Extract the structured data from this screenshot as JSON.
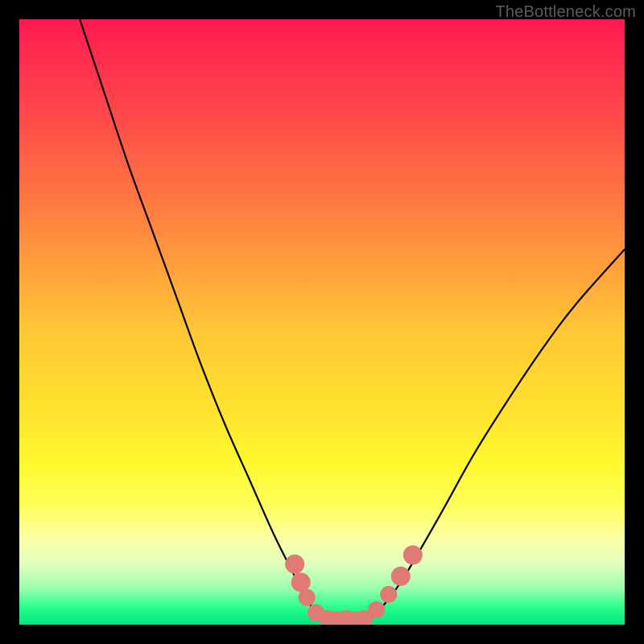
{
  "watermark": "TheBottleneck.com",
  "colors": {
    "frame_bg_top": "#ff1a52",
    "frame_bg_bottom": "#00e67a",
    "curve": "#000000",
    "marker": "#e07a74",
    "page_bg": "#000000",
    "watermark_text": "#5c5c5c"
  },
  "chart_data": {
    "type": "line",
    "title": "",
    "xlabel": "",
    "ylabel": "",
    "xlim": [
      0,
      100
    ],
    "ylim": [
      0,
      100
    ],
    "series": [
      {
        "name": "left-branch",
        "x": [
          10,
          14,
          18,
          22,
          26,
          30,
          34,
          38,
          42,
          45,
          47,
          49,
          50
        ],
        "y": [
          100,
          88,
          76,
          65,
          54,
          43,
          33,
          24,
          15,
          9,
          5,
          2,
          1
        ]
      },
      {
        "name": "right-branch",
        "x": [
          58,
          60,
          63,
          66,
          70,
          75,
          80,
          86,
          92,
          100
        ],
        "y": [
          1,
          3,
          7,
          12,
          19,
          28,
          36,
          45,
          53,
          62
        ]
      }
    ],
    "floor_segment": {
      "x": [
        50,
        58
      ],
      "y": 1
    },
    "markers": [
      {
        "x": 45.5,
        "y": 10,
        "r": 1.6
      },
      {
        "x": 46.5,
        "y": 7,
        "r": 1.6
      },
      {
        "x": 47.5,
        "y": 4.5,
        "r": 1.4
      },
      {
        "x": 49,
        "y": 2,
        "r": 1.4
      },
      {
        "x": 51,
        "y": 1,
        "r": 1.4
      },
      {
        "x": 54,
        "y": 1,
        "r": 1.4
      },
      {
        "x": 57,
        "y": 1,
        "r": 1.4
      },
      {
        "x": 59,
        "y": 2.5,
        "r": 1.4
      },
      {
        "x": 61,
        "y": 5,
        "r": 1.4
      },
      {
        "x": 63,
        "y": 8,
        "r": 1.6
      },
      {
        "x": 65,
        "y": 11.5,
        "r": 1.6
      }
    ],
    "floor_pill": {
      "x0": 49.5,
      "x1": 58,
      "y": 1,
      "thickness": 2.4
    }
  }
}
